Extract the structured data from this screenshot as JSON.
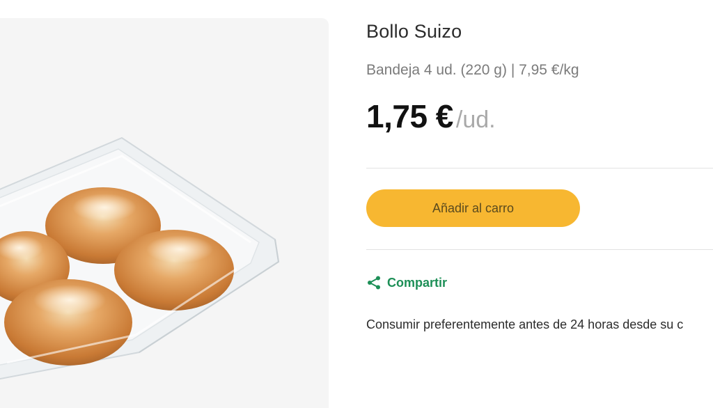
{
  "product": {
    "image_name": "bollo-suizo-tray-photo",
    "title": "Bollo Suizo",
    "subtitle": "Bandeja 4 ud. (220 g) | 7,95 €/kg",
    "price": "1,75 €",
    "price_unit": "/ud.",
    "add_to_cart_label": "Añadir al carro",
    "share_label": "Compartir",
    "share_icon": "share-icon",
    "note": "Consumir preferentemente antes de 24 horas desde su c"
  },
  "colors": {
    "button": "#f7b731",
    "share": "#1d8f57",
    "image_background": "#f5f5f5"
  }
}
